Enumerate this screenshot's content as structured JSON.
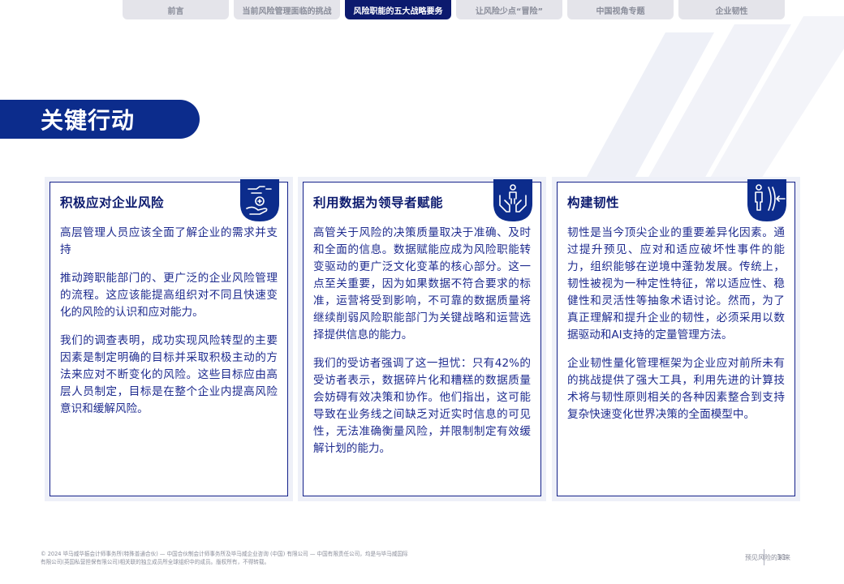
{
  "nav": {
    "tabs": [
      {
        "label": "前言",
        "active": false
      },
      {
        "label": "当前风险管理面临的挑战",
        "active": false
      },
      {
        "label": "风险职能的五大战略要务",
        "active": true
      },
      {
        "label": "让风险少点“冒险”",
        "active": false
      },
      {
        "label": "中国视角专题",
        "active": false
      },
      {
        "label": "企业韧性",
        "active": false
      }
    ]
  },
  "section": {
    "title": "关键行动"
  },
  "cards": [
    {
      "title": "积极应对企业风险",
      "icon": "handshake-coin-icon",
      "paragraphs": [
        "高层管理人员应该全面了解企业的需求并支持",
        "推动跨职能部门的、更广泛的企业风险管理的流程。这应该能提高组织对不同且快速变化的风险的认识和应对能力。",
        "我们的调查表明，成功实现风险转型的主要因素是制定明确的目标并采取积极主动的方法来应对不断变化的风险。这些目标应由高层人员制定，目标是在整个企业内提高风险意识和缓解风险。"
      ]
    },
    {
      "title": "利用数据为领导者赋能",
      "icon": "hands-person-icon",
      "paragraphs": [
        "高管关于风险的决策质量取决于准确、及时和全面的信息。数据赋能应成为风险职能转变驱动的更广泛文化变革的核心部分。这一点至关重要，因为如果数据不符合要求的标准，运营将受到影响，不可靠的数据质量将继续削弱风险职能部门为关键战略和运营选择提供信息的能力。",
        "我们的受访者强调了这一担忧：只有42%的受访者表示，数据碎片化和糟糕的数据质量会妨碍有效决策和协作。他们指出，这可能导致在业务线之间缺乏对近实时信息的可见性，无法准确衡量风险，并限制制定有效缓解计划的能力。"
      ]
    },
    {
      "title": "构建韧性",
      "icon": "person-shield-icon",
      "paragraphs": [
        "韧性是当今顶尖企业的重要差异化因素。通过提升预见、应对和适应破坏性事件的能力，组织能够在逆境中蓬勃发展。传统上，韧性被视为一种定性特征，常以适应性、稳健性和灵活性等抽象术语讨论。然而，为了真正理解和提升企业的韧性，必须采用以数据驱动和AI支持的定量管理方法。",
        "企业韧性量化管理框架为企业应对前所未有的挑战提供了强大工具，利用先进的计算技术将与韧性原则相关的各种因素整合到支持复杂快速变化世界决策的全面模型中。"
      ]
    }
  ],
  "footer": {
    "copyright_line1": "© 2024 毕马威华振会计师事务所(特殊普通合伙) — 中国合伙制会计师事务所及毕马威企业咨询 (中国) 有限公司 — 中国有限责任公司，均是与毕马威国际",
    "copyright_line2": "有限公司(英国私营担保有限公司)相关联的独立成员所全球组织中的成员。版权所有，不得转载。",
    "doc_title": "预见风险的未来",
    "page_number": "11"
  },
  "colors": {
    "navy": "#0c1a6e",
    "accent_blue": "#0c2c8c",
    "text_blue": "#1e2b8f",
    "tab_gray": "#e4e4ea"
  }
}
